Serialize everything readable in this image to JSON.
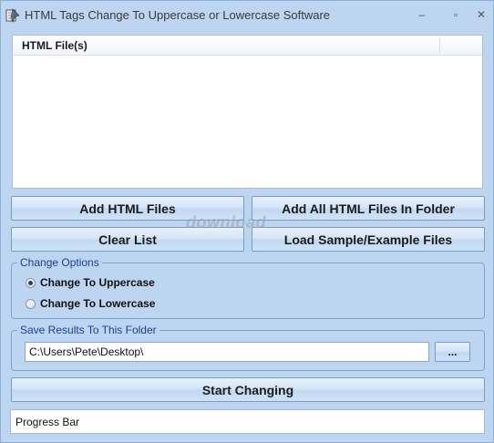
{
  "window": {
    "title": "HTML Tags Change To Uppercase or Lowercase Software",
    "minimize_glyph": "–",
    "maximize_glyph": "▫",
    "close_glyph": "✕"
  },
  "file_list": {
    "column_header": "HTML File(s)",
    "rows": []
  },
  "buttons": {
    "add_files": "Add HTML Files",
    "add_folder": "Add All HTML Files In Folder",
    "clear_list": "Clear List",
    "load_samples": "Load Sample/Example Files",
    "browse": "...",
    "start": "Start Changing"
  },
  "watermark": "download",
  "change_options": {
    "label": "Change Options",
    "options": [
      {
        "label": "Change To Uppercase",
        "selected": true
      },
      {
        "label": "Change To Lowercase",
        "selected": false
      }
    ]
  },
  "save_folder": {
    "label": "Save Results To This Folder",
    "path_value": "C:\\Users\\Pete\\Desktop\\"
  },
  "progress": {
    "label": "Progress Bar",
    "value": 0
  },
  "icons": {
    "app": "app-icon"
  },
  "colors": {
    "window_bg": "#bdd5f0",
    "group_label": "#1d3f8a"
  }
}
